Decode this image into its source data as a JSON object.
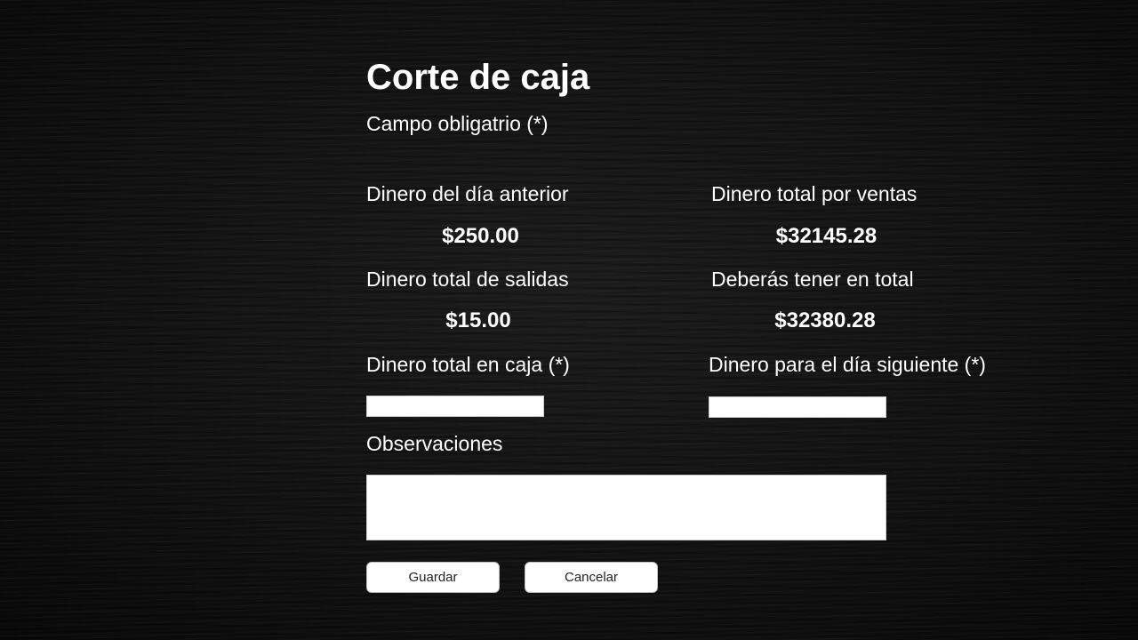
{
  "form": {
    "title": "Corte de caja",
    "required_note": "Campo obligatrio (*)",
    "fields": {
      "previous_day_money": {
        "label": "Dinero del día anterior",
        "value": "$250.00"
      },
      "sales_total": {
        "label": "Dinero total por ventas",
        "value": "$32145.28"
      },
      "outflows_total": {
        "label": "Dinero total de salidas",
        "value": "$15.00"
      },
      "expected_total": {
        "label": "Deberás tener en total",
        "value": "$32380.28"
      },
      "cash_in_register": {
        "label": "Dinero total en caja (*)",
        "value": "",
        "placeholder": ""
      },
      "next_day_money": {
        "label": "Dinero para el día siguiente (*)",
        "value": "",
        "placeholder": ""
      },
      "observations": {
        "label": "Observaciones",
        "value": "",
        "placeholder": ""
      }
    },
    "buttons": {
      "save": "Guardar",
      "cancel": "Cancelar"
    }
  }
}
